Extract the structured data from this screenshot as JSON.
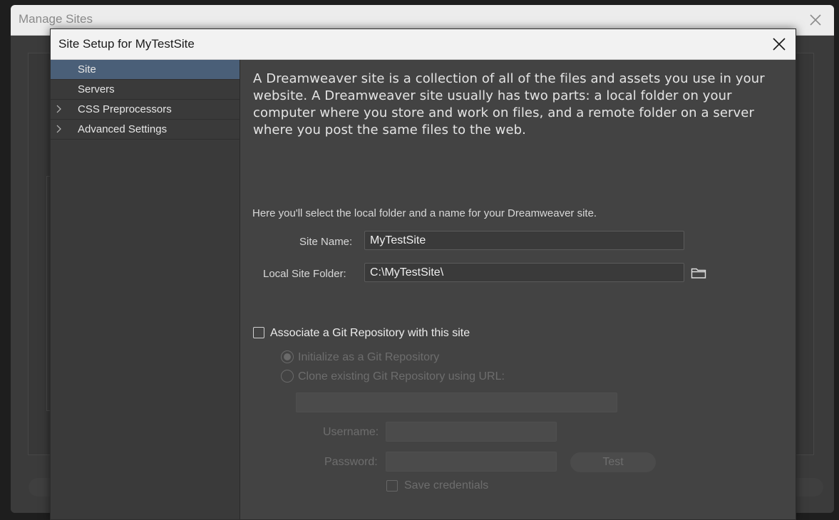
{
  "background_window": {
    "title": "Manage Sites"
  },
  "dialog": {
    "title": "Site Setup for MyTestSite"
  },
  "sidebar": {
    "items": [
      {
        "label": "Site",
        "active": true,
        "expandable": false
      },
      {
        "label": "Servers",
        "active": false,
        "expandable": false
      },
      {
        "label": "CSS Preprocessors",
        "active": false,
        "expandable": true
      },
      {
        "label": "Advanced Settings",
        "active": false,
        "expandable": true
      }
    ]
  },
  "content": {
    "intro": "A Dreamweaver site is a collection of all of the files and assets you use in your website. A Dreamweaver site usually has two parts: a local folder on your computer where you store and work on files, and a remote folder on a server where you post the same files to the web.",
    "subintro": "Here you'll select the local folder and a name for your Dreamweaver site.",
    "site_name_label": "Site Name:",
    "site_name_value": "MyTestSite",
    "local_folder_label": "Local Site Folder:",
    "local_folder_value": "C:\\MyTestSite\\",
    "git": {
      "associate_label": "Associate a Git Repository with this site",
      "associate_checked": false,
      "init_label": "Initialize as a Git Repository",
      "clone_label": "Clone existing Git Repository using URL:",
      "url_value": "",
      "username_label": "Username:",
      "username_value": "",
      "password_label": "Password:",
      "password_value": "",
      "test_label": "Test",
      "save_credentials_label": "Save credentials"
    }
  },
  "colors": {
    "accent_active_nav": "#4a5f78",
    "dialog_bg": "#434343",
    "sidebar_bg": "#3a3a3a",
    "titlebar_bg": "#f2f2f2"
  },
  "icons": {
    "close": "close-icon",
    "chevron": "chevron-right-icon",
    "folder": "folder-icon"
  }
}
